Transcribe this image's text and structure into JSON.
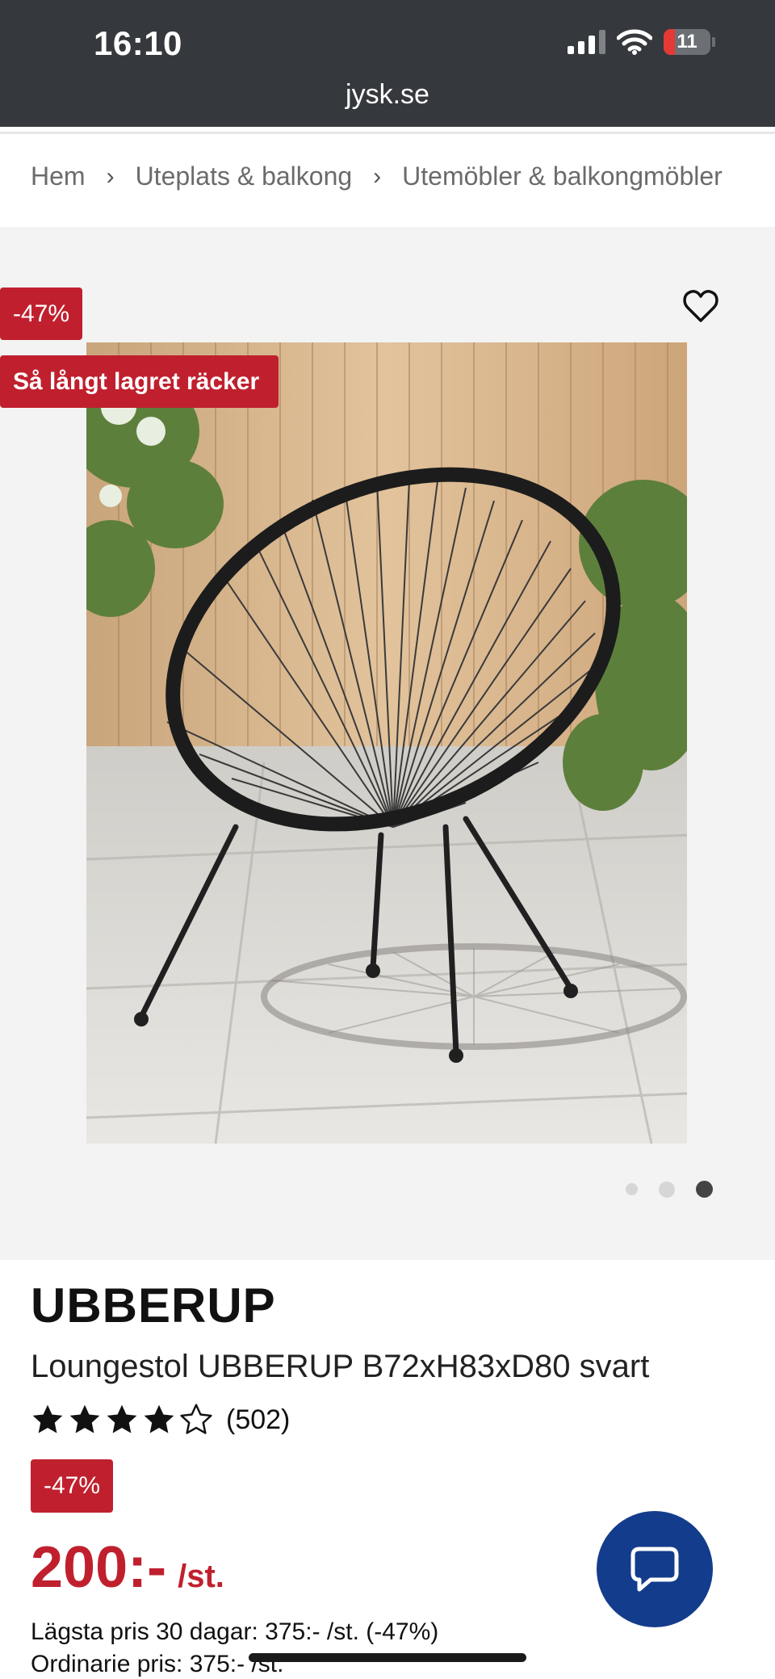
{
  "status_bar": {
    "time": "16:10",
    "battery": "11",
    "url": "jysk.se"
  },
  "breadcrumb": [
    {
      "label": "Hem"
    },
    {
      "label": "Uteplats & balkong"
    },
    {
      "label": "Utemöbler & balkongmöbler"
    }
  ],
  "gallery": {
    "discount_badge": "-47%",
    "stock_badge": "Så långt lagret räcker",
    "dots": [
      {
        "state": "inactive"
      },
      {
        "state": "inactive"
      },
      {
        "state": "active"
      }
    ]
  },
  "product": {
    "brand": "UBBERUP",
    "name": "Loungestol UBBERUP B72xH83xD80 svart",
    "rating": 4,
    "rating_max": 5,
    "review_count": "(502)",
    "discount_badge": "-47%",
    "price": "200:-",
    "price_unit": "/st.",
    "lowest_price_30_days": "Lägsta pris 30 dagar: 375:- /st. (-47%)",
    "regular_price": "Ordinarie pris: 375:- /st."
  },
  "icons": {
    "favorite": "heart-icon",
    "chat": "chat-icon",
    "wifi": "wifi-icon",
    "signal": "signal-icon",
    "battery": "battery-icon"
  },
  "colors": {
    "accent_red": "#c0202e",
    "chat_blue": "#143c8c",
    "status_bar_bg": "#35383c"
  }
}
